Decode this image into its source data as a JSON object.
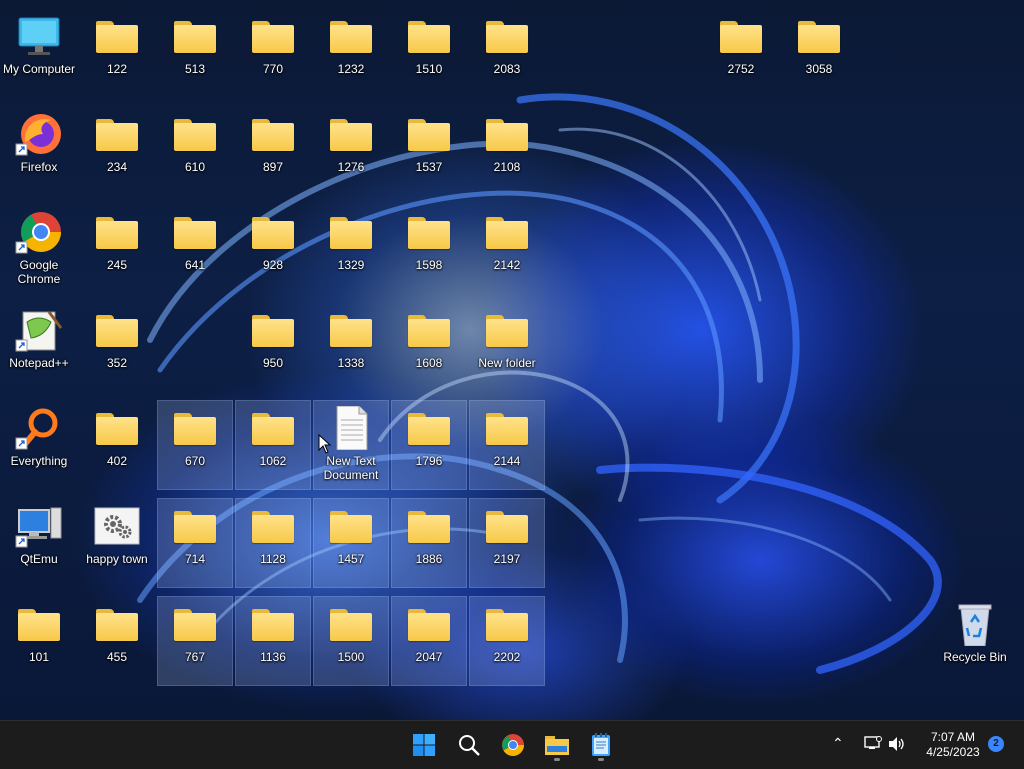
{
  "desktop": {
    "icons": [
      {
        "id": "my-computer",
        "label": "My Computer",
        "type": "computer"
      },
      {
        "id": "firefox",
        "label": "Firefox",
        "type": "firefox"
      },
      {
        "id": "chrome",
        "label": "Google Chrome",
        "type": "chrome"
      },
      {
        "id": "notepadpp",
        "label": "Notepad++",
        "type": "notepadpp"
      },
      {
        "id": "everything",
        "label": "Everything",
        "type": "everything"
      },
      {
        "id": "qtemu",
        "label": "QtEmu",
        "type": "qtemu"
      },
      {
        "id": "happy-town",
        "label": "happy town",
        "type": "settings"
      },
      {
        "id": "new-text-document",
        "label": "New Text Document",
        "type": "text"
      },
      {
        "id": "recycle-bin",
        "label": "Recycle Bin",
        "type": "recycle"
      }
    ],
    "folders": [
      "122",
      "513",
      "770",
      "1232",
      "1510",
      "2083",
      "2752",
      "3058",
      "234",
      "610",
      "897",
      "1276",
      "1537",
      "2108",
      "245",
      "641",
      "928",
      "1329",
      "1598",
      "2142",
      "352",
      "950",
      "1338",
      "1608",
      "New folder",
      "402",
      "670",
      "1062",
      "1796",
      "2144",
      "714",
      "1128",
      "1457",
      "1886",
      "2197",
      "101",
      "455",
      "767",
      "1136",
      "1500",
      "2047",
      "2202"
    ]
  },
  "taskbar": {
    "apps": [
      "start-icon",
      "search-icon",
      "chrome-icon",
      "file-explorer-icon",
      "notepad-icon"
    ],
    "time": "7:07 AM",
    "date": "4/25/2023",
    "notification_count": "2"
  },
  "colors": {
    "taskbar": "#1c1c1c",
    "folder": "#f7c948",
    "selection": "#b4cdff"
  }
}
